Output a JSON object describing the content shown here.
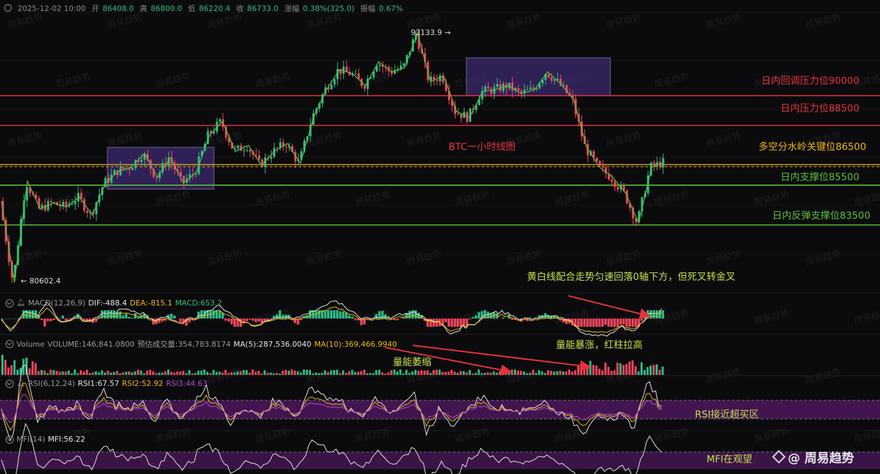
{
  "header": {
    "date": "2025-12-02 10:00",
    "open_label": "开",
    "open": "86408.0",
    "high_label": "高",
    "high": "86800.0",
    "low_label": "低",
    "low": "86220.4",
    "close_label": "收",
    "close": "86733.0",
    "change_label": "涨幅",
    "change": "0.38%(325.0)",
    "amplitude_label": "振幅",
    "amplitude": "0.67%"
  },
  "annotations": {
    "title": "BTC一小时线图",
    "high_mark": "93133.9 →",
    "low_mark": "← 80602.4",
    "level_90000": "日内回调压力位90000",
    "level_88500": "日内压力位88500",
    "level_86500": "多空分水岭关键位86500",
    "level_85500": "日内支撑位85500",
    "level_83500": "日内反弹支撑位83500",
    "macd_note": "黄白线配合走势匀速回落0轴下方，但死叉转金叉",
    "vol_up_note": "量能暴涨，红柱拉高",
    "vol_down_note": "量能萎缩",
    "rsi_note": "RSI接近超买区",
    "mfi_note": "MFI在观望",
    "brand": "@ 周易趋势",
    "watermark": "周易趋势"
  },
  "indicators": {
    "macd": {
      "name": "MACD(12,26,9)",
      "dif_label": "DIF:",
      "dif": "-488.4",
      "dea_label": "DEA:",
      "dea": "-815.1",
      "macd_label": "MACD:",
      "macd": "653.2"
    },
    "volume": {
      "name": "Volume",
      "volume_label": "VOLUME:",
      "volume": "146,841.0800",
      "est_label": "预估成交量:",
      "est": "354,783.8174",
      "ma5_label": "MA(5):",
      "ma5": "287,536.0040",
      "ma10_label": "MA(10):",
      "ma10": "369,466.9940"
    },
    "rsi": {
      "name": "RSI(6,12,24)",
      "rsi1_label": "RSI1:",
      "rsi1": "67.57",
      "rsi2_label": "RSI2:",
      "rsi2": "52.92",
      "rsi3_label": "RSI3:",
      "rsi3": "44.63"
    },
    "mfi": {
      "name": "MFI(14)",
      "mfi_label": "MFI:",
      "mfi": "56.22"
    }
  },
  "colors": {
    "up": "#2ebd85",
    "down": "#f6465d",
    "resistance": "#e8323c",
    "pivot": "#f0b90b",
    "support": "#5bc236",
    "box": "#3c2a6e",
    "yellow_line": "#f0b90b",
    "white_line": "#e6e6e6",
    "purple_line": "#b04fd1",
    "zone": "#5a1a6e"
  },
  "chart_data": {
    "type": "candlestick",
    "title": "BTC一小时线图",
    "extremes": {
      "high": 93133.9,
      "low": 80602.4
    },
    "levels": [
      {
        "value": 90000,
        "label": "日内回调压力位90000",
        "color": "#e8323c"
      },
      {
        "value": 88500,
        "label": "日内压力位88500",
        "color": "#e8323c"
      },
      {
        "value": 86500,
        "label": "多空分水岭关键位86500",
        "color": "#f0b90b"
      },
      {
        "value": 85500,
        "label": "日内支撑位85500",
        "color": "#5bc236"
      },
      {
        "value": 83500,
        "label": "日内反弹支撑位83500",
        "color": "#5bc236"
      }
    ],
    "price_path": [
      84700,
      80602.4,
      85700,
      84300,
      84600,
      84400,
      84900,
      84000,
      85600,
      86200,
      86400,
      87100,
      85900,
      86900,
      85600,
      86150,
      88000,
      88700,
      87200,
      87500,
      86500,
      87200,
      87600,
      86600,
      88900,
      90300,
      91300,
      91100,
      90500,
      91700,
      91200,
      91400,
      93133.9,
      90700,
      91000,
      89200,
      88900,
      90200,
      90300,
      90500,
      90100,
      90300,
      91200,
      90600,
      89800,
      87400,
      86400,
      85900,
      85100,
      83600,
      86400,
      86650
    ],
    "boxes": [
      {
        "from": 85300,
        "to": 87400
      },
      {
        "from": 90000,
        "to": 91900
      }
    ]
  }
}
